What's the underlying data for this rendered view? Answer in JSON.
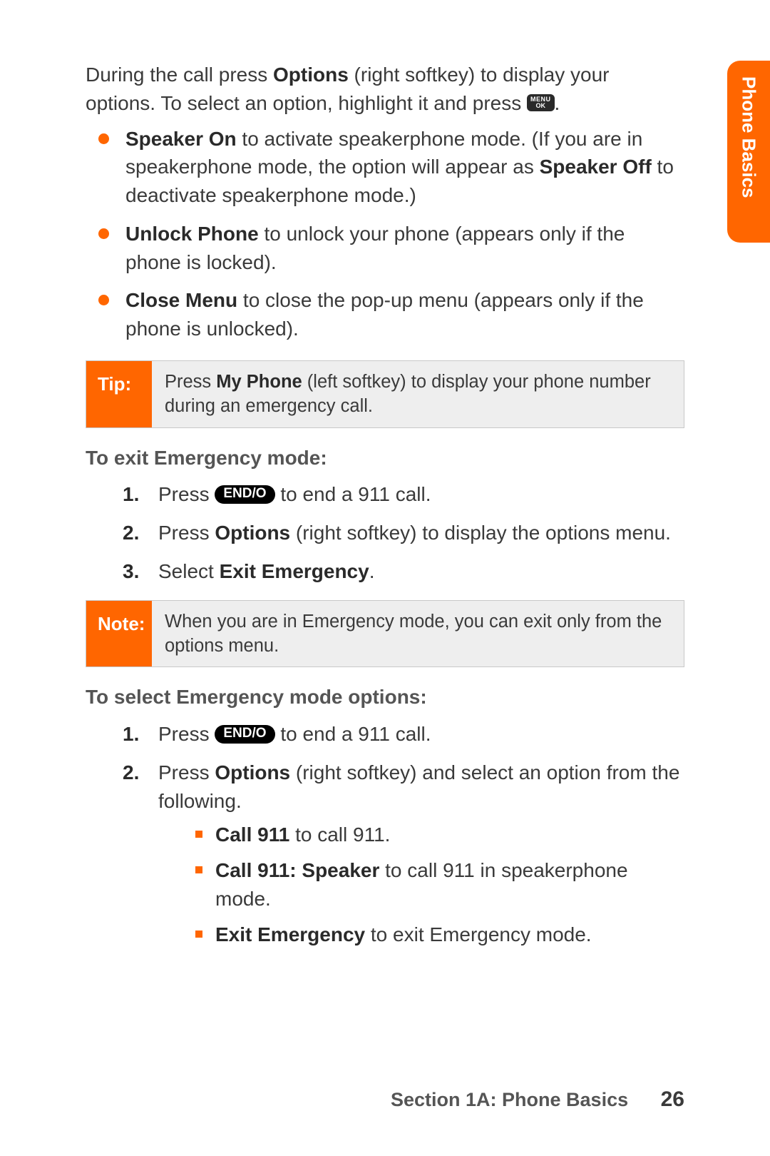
{
  "sideTab": "Phone Basics",
  "intro": {
    "t1": "During the call press ",
    "b1": "Options",
    "t2": " (right softkey) to display your options. To select an option, highlight it and press ",
    "menuTop": "MENU",
    "menuBot": "OK",
    "t3": "."
  },
  "bullets": [
    {
      "b1": "Speaker On",
      "t1": " to activate speakerphone mode. (If you are in speakerphone mode, the option will appear as ",
      "b2": "Speaker Off",
      "t2": " to deactivate speakerphone mode.)"
    },
    {
      "b1": "Unlock Phone",
      "t1": " to unlock your phone (appears only if the phone is locked).",
      "b2": "",
      "t2": ""
    },
    {
      "b1": "Close Menu",
      "t1": " to close the pop-up menu (appears only if the phone is unlocked).",
      "b2": "",
      "t2": ""
    }
  ],
  "tip": {
    "label": "Tip:",
    "t1": "Press ",
    "b1": "My Phone",
    "t2": " (left softkey) to display your phone number during an emergency call."
  },
  "exit": {
    "heading": "To exit Emergency mode:",
    "steps": {
      "s1a": "Press ",
      "endKey": "END/O",
      "s1b": "  to end a 911 call.",
      "s2a": "Press ",
      "s2b1": "Options",
      "s2c": " (right softkey) to display the options menu.",
      "s3a": "Select ",
      "s3b1": "Exit Emergency",
      "s3c": "."
    }
  },
  "note": {
    "label": "Note:",
    "text": "When you are in Emergency mode, you can exit only from the options menu."
  },
  "select": {
    "heading": "To select Emergency mode options:",
    "s1a": "Press ",
    "endKey": "END/O",
    "s1b": "  to end a 911 call.",
    "s2a": "Press ",
    "s2b1": "Options",
    "s2c": " (right softkey) and select an option from the following.",
    "sub": [
      {
        "b": "Call 911",
        "t": " to call 911."
      },
      {
        "b": "Call 911: Speaker",
        "t": " to call 911 in speakerphone mode."
      },
      {
        "b": "Exit Emergency",
        "t": " to exit Emergency mode."
      }
    ]
  },
  "footer": {
    "section": "Section 1A: Phone Basics",
    "page": "26"
  }
}
